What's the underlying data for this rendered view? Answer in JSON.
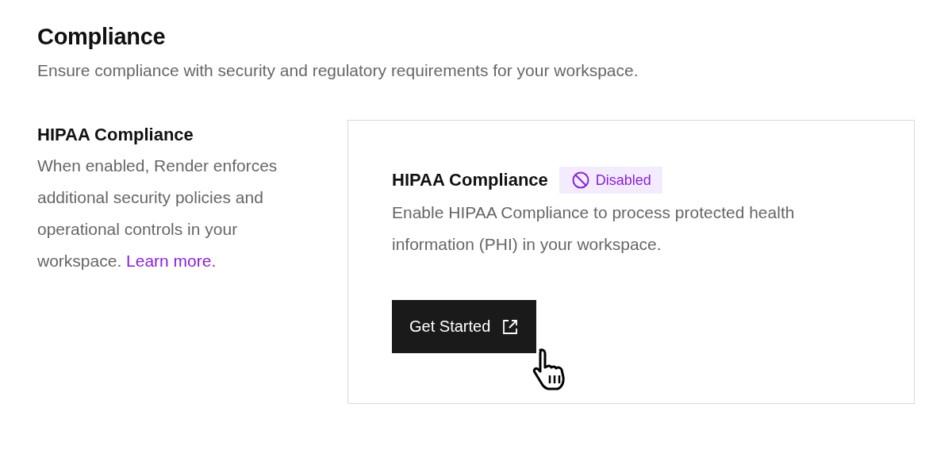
{
  "section": {
    "title": "Compliance",
    "description": "Ensure compliance with security and regulatory requirements for your workspace."
  },
  "setting": {
    "title": "HIPAA Compliance",
    "description": "When enabled, Render enforces additional security policies and operational controls in your workspace.",
    "link": "Learn more."
  },
  "card": {
    "title": "HIPAA Compliance",
    "badge": {
      "label": "Disabled",
      "enabled": false
    },
    "description": "Enable HIPAA Compliance to process protected health information (PHI) in your workspace.",
    "button": "Get Started"
  }
}
